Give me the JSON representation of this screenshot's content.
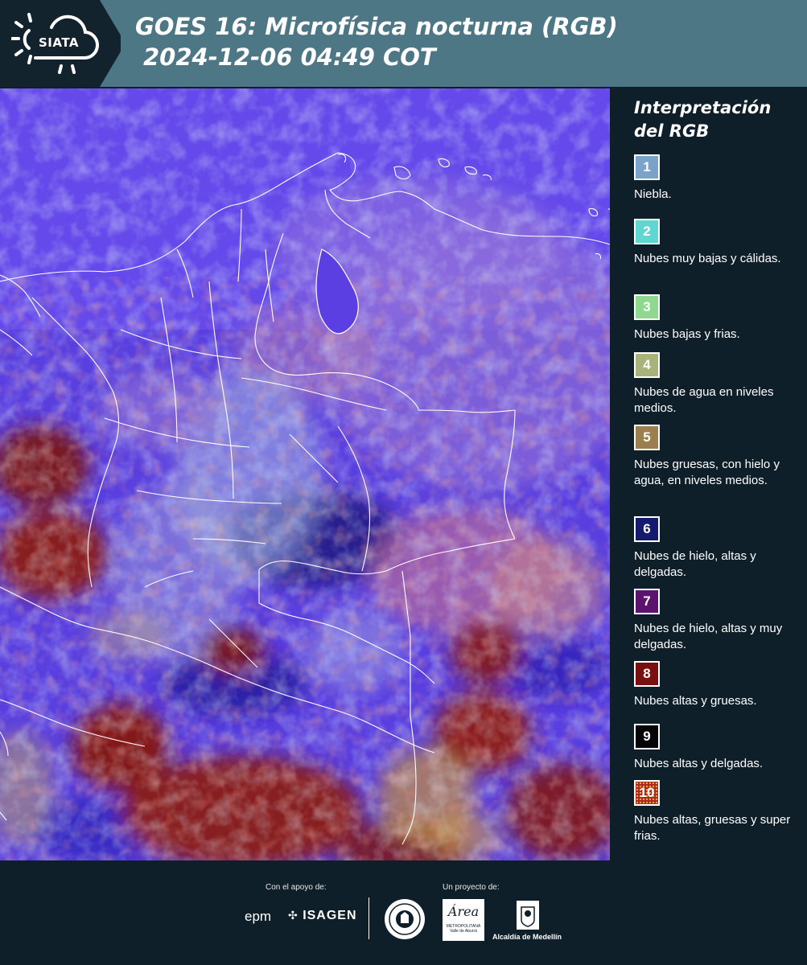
{
  "header": {
    "logo_text": "SIATA",
    "title_line1": "GOES 16: Microfísica nocturna (RGB)",
    "title_line2": "2024-12-06 04:49 COT"
  },
  "legend": {
    "title_line1": "Interpretación",
    "title_line2": "del RGB",
    "items": [
      {
        "number": "1",
        "color": "#7ba3c9",
        "label": "Niebla."
      },
      {
        "number": "2",
        "color": "#5fd6d0",
        "label": "Nubes muy bajas y cálidas."
      },
      {
        "number": "3",
        "color": "#8fd88f",
        "label": "Nubes bajas y frias."
      },
      {
        "number": "4",
        "color": "#a7b378",
        "label": "Nubes de agua en niveles medios."
      },
      {
        "number": "5",
        "color": "#9b7f4f",
        "label": "Nubes gruesas, con hielo y agua, en niveles medios."
      },
      {
        "number": "6",
        "color": "#141a6e",
        "label": "Nubes de hielo, altas y delgadas."
      },
      {
        "number": "7",
        "color": "#5c1370",
        "label": "Nubes de hielo, altas y muy delgadas."
      },
      {
        "number": "8",
        "color": "#7a0f0f",
        "label": "Nubes altas y gruesas."
      },
      {
        "number": "9",
        "color": "#050508",
        "label": "Nubes altas y delgadas."
      },
      {
        "number": "10",
        "color": "#b0281c",
        "label": "Nubes altas, gruesas y super frias."
      }
    ]
  },
  "footer": {
    "support_label": "Con el apoyo de:",
    "project_label": "Un proyecto de:",
    "epm": "epm",
    "isagen": "ISAGEN",
    "area_logo": "Área",
    "area_line1": "METROPOLITANA",
    "area_line2": "Valle de Aburrá",
    "medellin": "Alcaldía de Medellín"
  }
}
